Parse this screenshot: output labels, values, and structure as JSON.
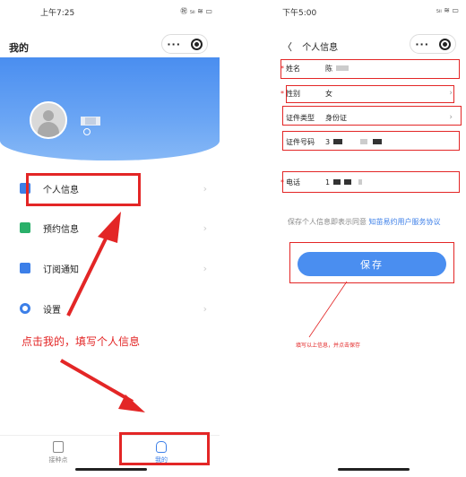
{
  "left": {
    "status": {
      "time": "上午7:25",
      "signal": "㊗ ₅ₗₗ ≋ ▭"
    },
    "capsule": {
      "dots": "···"
    },
    "title": "我的",
    "menu": [
      {
        "label": "个人信息",
        "icon": "person-card-icon"
      },
      {
        "label": "预约信息",
        "icon": "calendar-icon"
      },
      {
        "label": "订阅通知",
        "icon": "bell-icon"
      },
      {
        "label": "设置",
        "icon": "gear-icon"
      }
    ],
    "chevron": "›",
    "instruction": "点击我的，填写个人信息",
    "tabs": [
      {
        "label": "接种点",
        "icon": "site-icon"
      },
      {
        "label": "我的",
        "icon": "profile-icon"
      }
    ]
  },
  "right": {
    "status": {
      "time": "下午5:00",
      "signal": "₅ₗₗ ≋ ▭"
    },
    "capsule": {
      "dots": "···"
    },
    "back": "〈",
    "title": "个人信息",
    "fields": [
      {
        "required": "*",
        "label": "姓名",
        "value": "陈"
      },
      {
        "required": "*",
        "label": "性别",
        "value": "女"
      },
      {
        "required": "",
        "label": "证件类型",
        "value": "身份证"
      },
      {
        "required": "",
        "label": "证件号码",
        "value": "3"
      },
      {
        "required": "*",
        "label": "电话",
        "value": "1"
      }
    ],
    "chevron": "›",
    "agreement_prefix": "保存个人信息即表示同意",
    "agreement_link": "知苗易约用户服务协议",
    "save_label": "保存",
    "instruction": "填写以上信息，并点击保存"
  },
  "colors": {
    "accent": "#4a8ef0",
    "highlight": "#e32626"
  }
}
